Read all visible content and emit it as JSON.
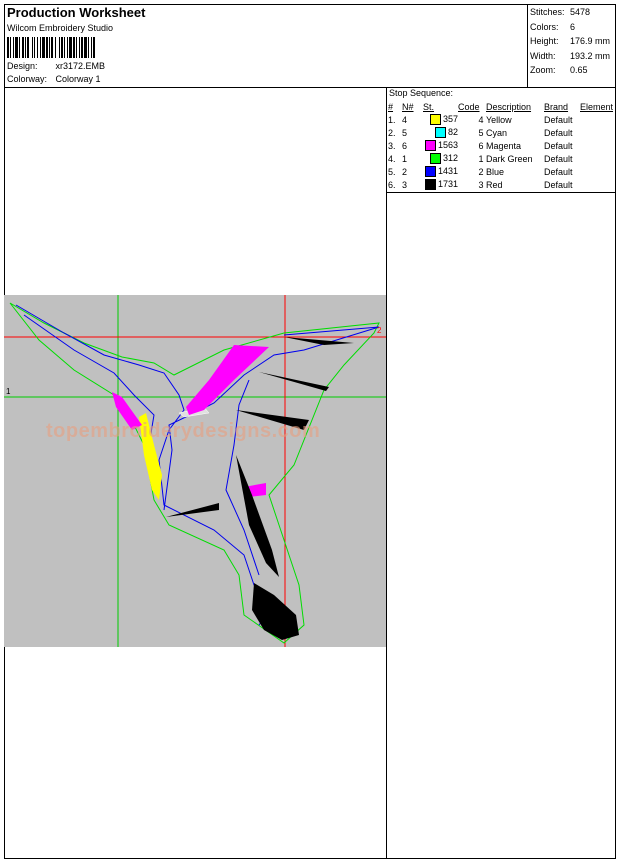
{
  "header": {
    "title": "Production Worksheet",
    "software": "Wilcom Embroidery Studio",
    "design_label": "Design:",
    "design_value": "xr3172.EMB",
    "colorway_label": "Colorway:",
    "colorway_value": "Colorway 1"
  },
  "stats": [
    {
      "label": "Stitches:",
      "value": "5478"
    },
    {
      "label": "Colors:",
      "value": "6"
    },
    {
      "label": "Height:",
      "value": "176.9 mm"
    },
    {
      "label": "Width:",
      "value": "193.2 mm"
    },
    {
      "label": "Zoom:",
      "value": "0.65"
    }
  ],
  "stop_sequence": {
    "title": "Stop Sequence:",
    "columns": [
      "#",
      "N#",
      "St.",
      "Code",
      "Description",
      "Brand",
      "Element"
    ],
    "rows": [
      {
        "num": "1.",
        "n": "4",
        "st": "357",
        "code": "4",
        "desc": "Yellow",
        "brand": "Default",
        "element": "",
        "color": "#ffff00"
      },
      {
        "num": "2.",
        "n": "5",
        "st": "82",
        "code": "5",
        "desc": "Cyan",
        "brand": "Default",
        "element": "",
        "color": "#00ffff"
      },
      {
        "num": "3.",
        "n": "6",
        "st": "1563",
        "code": "6",
        "desc": "Magenta",
        "brand": "Default",
        "element": "",
        "color": "#ff00ff"
      },
      {
        "num": "4.",
        "n": "1",
        "st": "312",
        "code": "1",
        "desc": "Dark Green",
        "brand": "Default",
        "element": "",
        "color": "#00ff00"
      },
      {
        "num": "5.",
        "n": "2",
        "st": "1431",
        "code": "2",
        "desc": "Blue",
        "brand": "Default",
        "element": "",
        "color": "#0000ff"
      },
      {
        "num": "6.",
        "n": "3",
        "st": "1731",
        "code": "3",
        "desc": "Red",
        "brand": "Default",
        "element": "",
        "color": "#000000"
      }
    ]
  },
  "preview": {
    "watermark": "topembroiderydesigns.com",
    "marker_1": "1",
    "marker_2": "2",
    "background": "#c0c0c0",
    "crosshair_color": "#ff0000",
    "guide_color": "#00cc00"
  }
}
